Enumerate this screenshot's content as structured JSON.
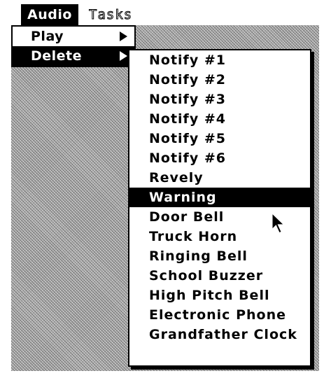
{
  "menubar": {
    "items": [
      {
        "label": "Audio"
      },
      {
        "label": "Tasks"
      }
    ]
  },
  "audio_menu": {
    "items": [
      {
        "label": "Play"
      },
      {
        "label": "Delete"
      }
    ]
  },
  "delete_submenu": {
    "items": [
      {
        "label": "Notify #1"
      },
      {
        "label": "Notify #2"
      },
      {
        "label": "Notify #3"
      },
      {
        "label": "Notify #4"
      },
      {
        "label": "Notify #5"
      },
      {
        "label": "Notify #6"
      },
      {
        "label": "Revely"
      },
      {
        "label": "Warning"
      },
      {
        "label": "Door Bell"
      },
      {
        "label": "Truck Horn"
      },
      {
        "label": "Ringing Bell"
      },
      {
        "label": "School Buzzer"
      },
      {
        "label": "High Pitch Bell"
      },
      {
        "label": "Electronic Phone"
      },
      {
        "label": "Grandfather Clock"
      }
    ],
    "highlighted": "Warning"
  },
  "icons": {
    "submenu_arrow": "right-triangle-icon",
    "cursor": "arrow-cursor-icon"
  },
  "colors": {
    "highlight_bg": "#000000",
    "highlight_text": "#ffffff"
  }
}
